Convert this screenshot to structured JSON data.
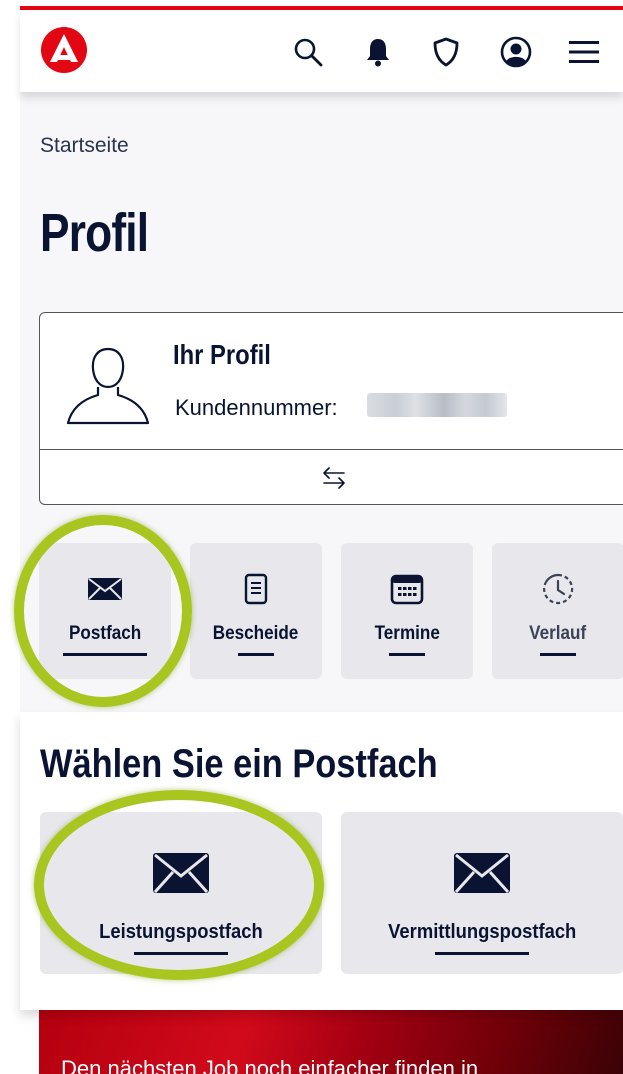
{
  "header": {
    "logo": "agency-logo",
    "icons": [
      "search-icon",
      "bell-icon",
      "shield-icon",
      "account-icon",
      "menu-icon"
    ],
    "accent": "#e30613"
  },
  "breadcrumb": "Startseite",
  "page_title": "Profil",
  "profile": {
    "heading": "Ihr Profil",
    "customer_label": "Kundennummer:"
  },
  "tiles": [
    {
      "label": "Postfach",
      "icon": "envelope-icon"
    },
    {
      "label": "Bescheide",
      "icon": "document-icon"
    },
    {
      "label": "Termine",
      "icon": "calendar-icon"
    },
    {
      "label": "Verlauf",
      "icon": "history-icon"
    }
  ],
  "section": {
    "title": "Wählen Sie ein Postfach",
    "boxes": [
      {
        "label": "Leistungspostfach",
        "icon": "envelope-icon"
      },
      {
        "label": "Vermittlungspostfach",
        "icon": "envelope-icon"
      }
    ]
  },
  "banner": {
    "text": "Den nächsten Job noch einfacher finden in"
  },
  "highlight_color": "#a8c520"
}
